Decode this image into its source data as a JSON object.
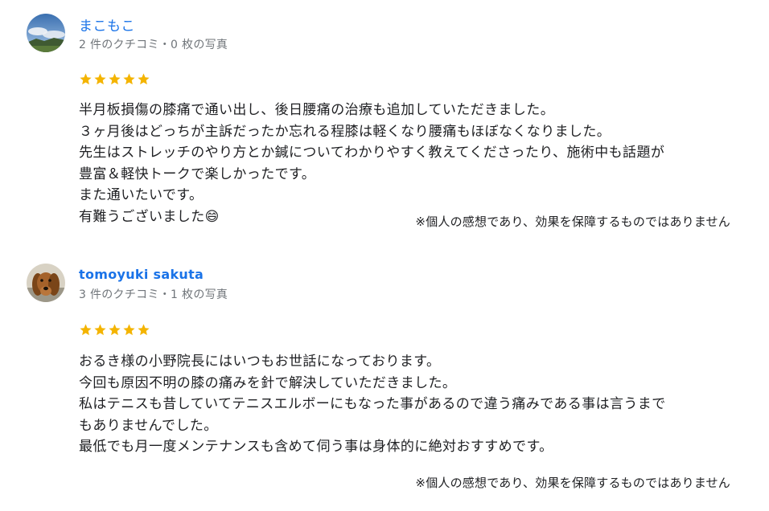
{
  "reviews": [
    {
      "name": "まこもこ",
      "meta": "2 件のクチコミ・0 枚の写真",
      "rating": 5,
      "avatar_icon": "landscape-avatar-icon",
      "lines": [
        "半月板損傷の膝痛で通い出し、後日腰痛の治療も追加していただきました。",
        "３ヶ月後はどっちが主訴だったか忘れる程膝は軽くなり腰痛もほぼなくなりました。",
        "先生はストレッチのやり方とか鍼についてわかりやすく教えてくださったり、施術中も話題が",
        "豊富＆軽快トークで楽しかったです。",
        "また通いたいです。",
        "有難うございました😄"
      ],
      "disclaimer": "※個人の感想であり、効果を保障するものではありません"
    },
    {
      "name": "tomoyuki sakuta",
      "meta": "3 件のクチコミ・1 枚の写真",
      "rating": 5,
      "avatar_icon": "dog-avatar-icon",
      "lines": [
        "おるき様の小野院長にはいつもお世話になっております。",
        "今回も原因不明の膝の痛みを針で解決していただきました。",
        "私はテニスも昔していてテニスエルボーにもなった事があるので違う痛みである事は言うまで",
        "もありませんでした。",
        "最低でも月一度メンテナンスも含めて伺う事は身体的に絶対おすすめです。"
      ],
      "disclaimer": "※個人の感想であり、効果を保障するものではありません"
    }
  ],
  "colors": {
    "star": "#f4b400",
    "name": "#1a73e8",
    "meta": "#70757a",
    "text": "#202124"
  }
}
